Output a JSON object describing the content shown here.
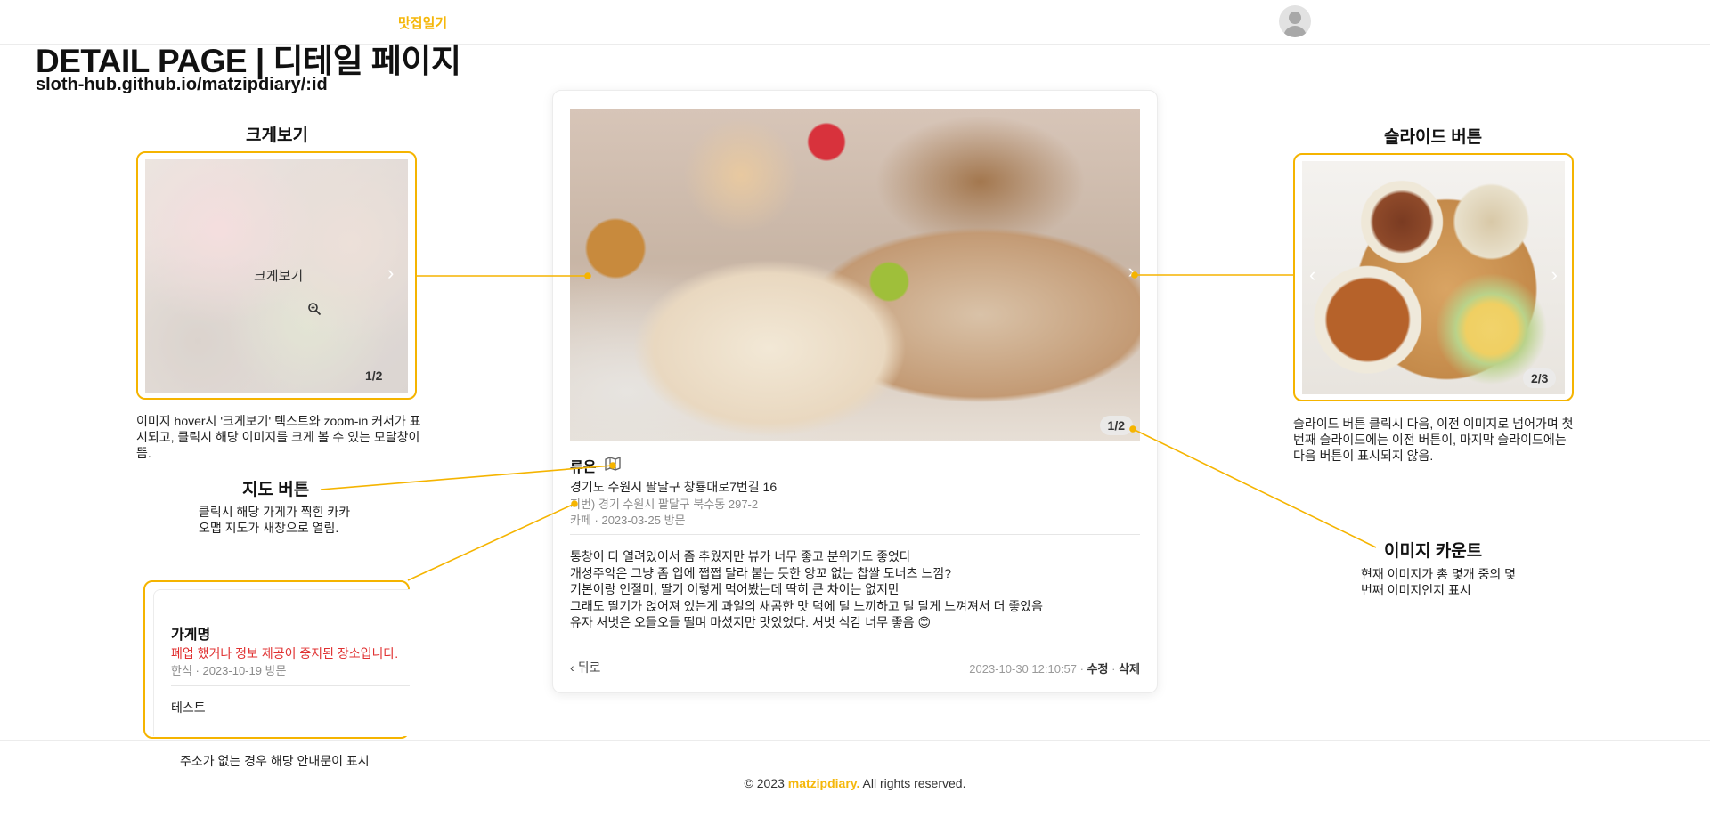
{
  "nav": {
    "logo": "맛집일기"
  },
  "header": {
    "title": "DETAIL PAGE | 디테일 페이지",
    "url": "sloth-hub.github.io/matzipdiary/:id"
  },
  "annotations": {
    "zoom": {
      "title": "크게보기",
      "desc": "이미지 hover시 '크게보기' 텍스트와 zoom-in 커서가 표시되고, 클릭시 해당 이미지를 크게 볼 수 있는 모달창이 뜸."
    },
    "map_button": {
      "title": "지도 버튼",
      "desc": "클릭시 해당 가게가 찍힌 카카오맵 지도가 새창으로 열림."
    },
    "store_name": {
      "desc": "주소가 없는 경우 해당 안내문이 표시"
    },
    "slide": {
      "title": "슬라이드 버튼",
      "desc": "슬라이드 버튼 클릭시 다음, 이전 이미지로 넘어가며 첫번째 슬라이드에는 이전 버튼이, 마지막 슬라이드에는 다음 버튼이 표시되지 않음."
    },
    "image_count": {
      "title": "이미지 카운트",
      "desc": "현재 이미지가 총 몇개 중의 몇번째 이미지인지 표시"
    }
  },
  "zoom_example": {
    "label": "크게보기",
    "count": "1/2"
  },
  "slide_example": {
    "count": "2/3"
  },
  "detail": {
    "image_count": "1/2",
    "store_name": "류온",
    "address": "경기도 수원시 팔달구 창룡대로7번길 16",
    "jibun": "지번) 경기 수원시 팔달구 북수동 297-2",
    "meta": "카페 · 2023-03-25 방문",
    "review": "통창이 다 열려있어서 좀 추웠지만 뷰가 너무 좋고 분위기도 좋었다\n개성주악은 그냥 좀 입에 쩝쩝 달라 붙는 듯한 앙꼬 없는 찹쌀 도너츠 느낌?\n기본이랑 인절미, 딸기 이렇게 먹어봤는데 딱히 큰 차이는 없지만\n그래도 딸기가 얹어져 있는게 과일의 새콤한 맛 덕에 덜 느끼하고 덜 달게 느껴져서 더 좋았음\n유자 셔벗은 오들오들 떨며 마셨지만 맛있었다. 셔벗 식감 너무 좋음 😊",
    "back_label": "뒤로",
    "timestamp": "2023-10-30 12:10:57",
    "edit_label": "수정",
    "delete_label": "삭제"
  },
  "closed_example": {
    "name": "가게명",
    "warning": "폐업 했거나 정보 제공이 중지된 장소입니다.",
    "meta": "한식 · 2023-10-19 방문",
    "review": "테스트"
  },
  "footer": {
    "prefix": "© 2023 ",
    "brand": "matzipdiary.",
    "suffix": " All rights reserved."
  },
  "colors": {
    "accent": "#f5b70a",
    "annotation_line": "#f5b400",
    "warning": "#e03131"
  }
}
